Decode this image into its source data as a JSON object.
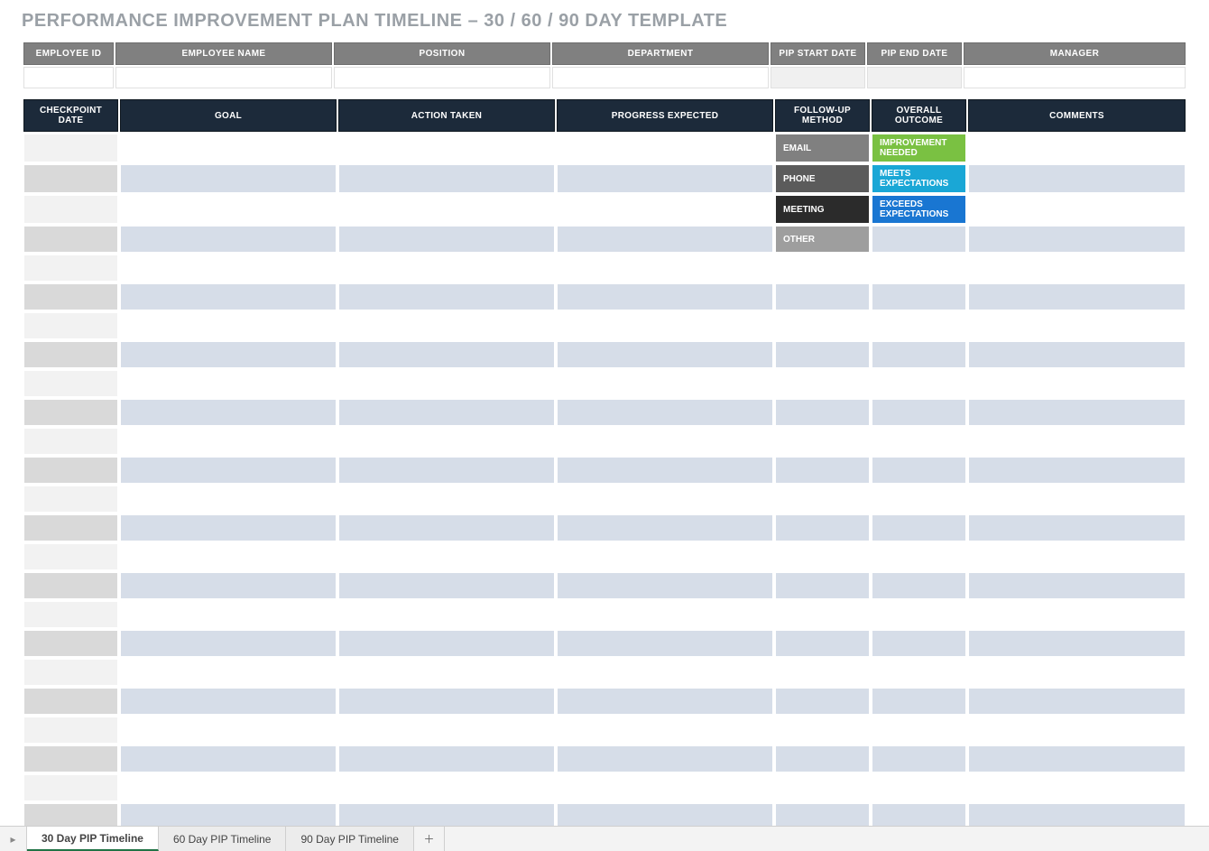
{
  "title": "PERFORMANCE IMPROVEMENT PLAN TIMELINE  –  30 / 60 / 90 DAY TEMPLATE",
  "info_headers": {
    "employee_id": "EMPLOYEE ID",
    "employee_name": "EMPLOYEE NAME",
    "position": "POSITION",
    "department": "DEPARTMENT",
    "pip_start": "PIP START DATE",
    "pip_end": "PIP END DATE",
    "manager": "MANAGER"
  },
  "info_values": {
    "employee_id": "",
    "employee_name": "",
    "position": "",
    "department": "",
    "pip_start": "",
    "pip_end": "",
    "manager": ""
  },
  "timeline_headers": {
    "checkpoint": "CHECKPOINT DATE",
    "goal": "GOAL",
    "action": "ACTION TAKEN",
    "progress": "PROGRESS EXPECTED",
    "followup_method": "FOLLOW-UP METHOD",
    "overall_outcome": "OVERALL OUTCOME",
    "comments": "COMMENTS"
  },
  "followup_options": {
    "email": "EMAIL",
    "phone": "PHONE",
    "meeting": "MEETING",
    "other": "OTHER"
  },
  "outcome_options": {
    "improvement": "IMPROVEMENT NEEDED",
    "meets": "MEETS EXPECTATIONS",
    "exceeds": "EXCEEDS EXPECTATIONS"
  },
  "row_count": 24,
  "sheet_tabs": {
    "tab1": "30 Day PIP Timeline",
    "tab2": "60 Day PIP Timeline",
    "tab3": "90 Day PIP Timeline"
  }
}
